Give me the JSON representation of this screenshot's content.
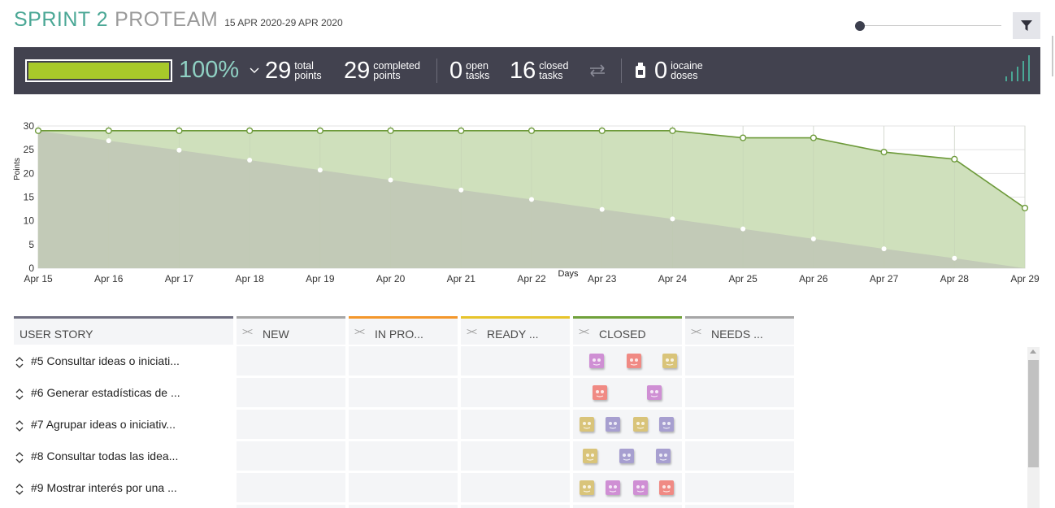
{
  "header": {
    "sprint_name": "SPRINT 2",
    "team_name": "PROTEAM",
    "date_range": "15 APR 2020-29 APR 2020"
  },
  "stats": {
    "progress_percent": 100,
    "progress_text": "100%",
    "total_points": "29",
    "total_points_label1": "total",
    "total_points_label2": "points",
    "completed_points": "29",
    "completed_points_label1": "completed",
    "completed_points_label2": "points",
    "open_tasks": "0",
    "open_tasks_label1": "open",
    "open_tasks_label2": "tasks",
    "closed_tasks": "16",
    "closed_tasks_label1": "closed",
    "closed_tasks_label2": "tasks",
    "iocaine_doses": "0",
    "iocaine_label1": "iocaine",
    "iocaine_label2": "doses"
  },
  "chart_data": {
    "type": "area",
    "title": "",
    "xlabel": "Days",
    "ylabel": "Points",
    "ylim": [
      0,
      30
    ],
    "yticks": [
      "0",
      "5",
      "10",
      "15",
      "20",
      "25",
      "30"
    ],
    "categories": [
      "Apr 15",
      "Apr 16",
      "Apr 17",
      "Apr 18",
      "Apr 19",
      "Apr 20",
      "Apr 21",
      "Apr 22",
      "Apr 23",
      "Apr 24",
      "Apr 25",
      "Apr 26",
      "Apr 27",
      "Apr 28",
      "Apr 29"
    ],
    "series": [
      {
        "name": "",
        "color": "#6d9a3a",
        "fill": "#cfe0bc",
        "values": [
          29,
          29,
          29,
          29,
          29,
          29,
          29,
          29,
          29,
          29,
          27.5,
          27.5,
          24.5,
          23,
          12.7
        ]
      },
      {
        "name": "",
        "color": "#b9bdb0",
        "fill": "#c0c6b6",
        "values": [
          29,
          26.9,
          24.9,
          22.8,
          20.7,
          18.6,
          16.5,
          14.5,
          12.4,
          10.4,
          8.3,
          6.2,
          4.1,
          2.1,
          0
        ]
      }
    ],
    "grid": true
  },
  "board": {
    "columns": [
      {
        "label": "USER STORY",
        "color": "#6e6e80"
      },
      {
        "label": "NEW",
        "color": "#a6a6a6"
      },
      {
        "label": "IN PRO...",
        "color": "#f4972b"
      },
      {
        "label": "READY ...",
        "color": "#e7c42a"
      },
      {
        "label": "CLOSED",
        "color": "#70a13a"
      },
      {
        "label": "NEEDS ...",
        "color": "#a6a6a6"
      }
    ],
    "stories": [
      {
        "title": "#5 Consultar ideas o iniciati...",
        "avatars": [
          "purple-face",
          "red-face",
          "yellow-face"
        ]
      },
      {
        "title": "#6 Generar estadísticas de ...",
        "avatars": [
          "red-face",
          "purple-face"
        ]
      },
      {
        "title": "#7 Agrupar ideas o iniciativ...",
        "avatars": [
          "yellow-face",
          "lilac-face",
          "yellow-face",
          "lilac-face"
        ]
      },
      {
        "title": "#8 Consultar todas las idea...",
        "avatars": [
          "yellow-face",
          "lilac-face",
          "lilac-face"
        ]
      },
      {
        "title": "#9 Mostrar interés por una ...",
        "avatars": [
          "yellow-face",
          "purple-face",
          "purple-face",
          "red-face"
        ]
      }
    ],
    "avatar_colors": {
      "purple-face": "#cf8fd4",
      "red-face": "#f08a84",
      "yellow-face": "#d9c47a",
      "lilac-face": "#a79fd0"
    }
  }
}
